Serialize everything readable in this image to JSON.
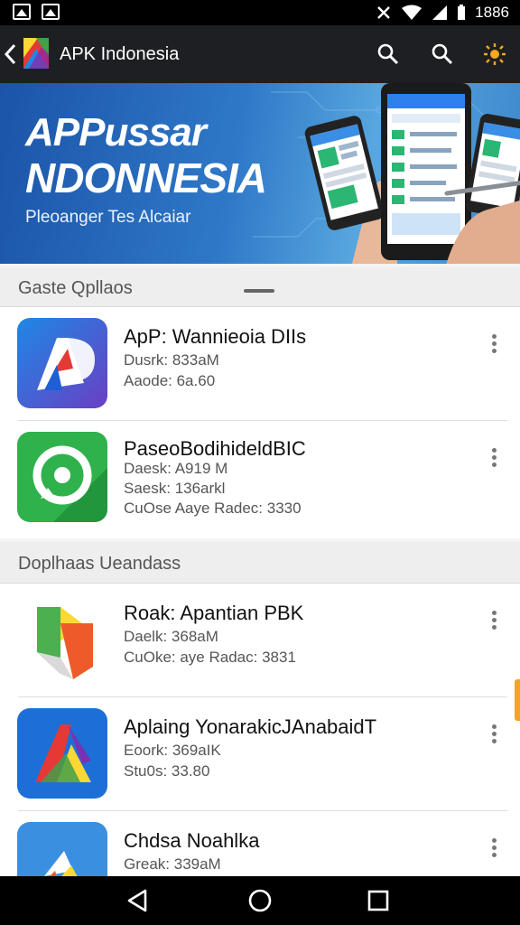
{
  "status_bar": {
    "time": "1886"
  },
  "app_bar": {
    "title": "APK Indonesia"
  },
  "banner": {
    "title_line1": "APPussar",
    "title_line2": "NDONNESIA",
    "subtitle": "Pleoanger Tes Alcaiar"
  },
  "sections": [
    {
      "label": "Gaste Qpllaos",
      "items": [
        {
          "name": "ApP: Wannieoia DIIs",
          "line1": "Dusrk: 833aM",
          "line2": "Aaode: 6a.60"
        },
        {
          "name": "PaseoBodihideldBIC",
          "line1": "Daesk: A919 M",
          "line2": "Saesk: 136arkl",
          "line3": "CuOse Aaye Radec: 3330"
        }
      ]
    },
    {
      "label": "Doplhaas Ueandass",
      "items": [
        {
          "name": "Roak: Apantian PBK",
          "line1": "Daelk: 368aM",
          "line2": "CuOke: aye Radac: 3831"
        },
        {
          "name": "Aplaing YonarakicJAnabaidT",
          "line1": "Eoork: 369aIK",
          "line2": "Stu0s: 33.80"
        },
        {
          "name": "Chdsa Noahlka",
          "line1": "Greak: 339aM"
        }
      ]
    }
  ],
  "icons": {
    "status_left": [
      "image-icon",
      "image-icon"
    ],
    "status_right": [
      "vibrate-icon",
      "wifi-icon",
      "signal-icon",
      "battery-icon"
    ],
    "app_bar": [
      "back-icon",
      "search-icon",
      "search-icon",
      "brightness-icon"
    ],
    "nav": [
      "back-triangle-icon",
      "home-circle-icon",
      "recents-square-icon"
    ]
  },
  "colors": {
    "app_bar": "#1e1f22",
    "banner_blue": "#2f78c8",
    "accent_orange": "#f3a22b"
  }
}
